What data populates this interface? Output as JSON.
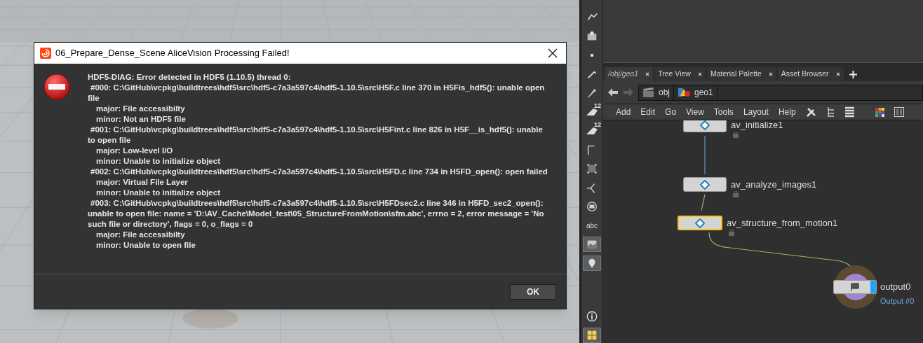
{
  "dialog": {
    "title": "06_Prepare_Dense_Scene AliceVision Processing Failed!",
    "lines": [
      {
        "kind": "heading",
        "text": "HDF5-DIAG: Error detected in HDF5 (1.10.5) thread 0:"
      },
      {
        "kind": "frame",
        "text": "#000: C:\\GitHub\\vcpkg\\buildtrees\\hdf5\\src\\hdf5-c7a3a597c4\\hdf5-1.10.5\\src\\H5F.c line 370 in H5Fis_hdf5(): unable open"
      },
      {
        "kind": "wrap",
        "text": "file"
      },
      {
        "kind": "detail",
        "text": "major: File accessibilty"
      },
      {
        "kind": "detail",
        "text": "minor: Not an HDF5 file"
      },
      {
        "kind": "frame",
        "text": "#001: C:\\GitHub\\vcpkg\\buildtrees\\hdf5\\src\\hdf5-c7a3a597c4\\hdf5-1.10.5\\src\\H5Fint.c line 826 in H5F__is_hdf5(): unable"
      },
      {
        "kind": "wrap",
        "text": "to open file"
      },
      {
        "kind": "detail",
        "text": "major: Low-level I/O"
      },
      {
        "kind": "detail",
        "text": "minor: Unable to initialize object"
      },
      {
        "kind": "frame",
        "text": "#002: C:\\GitHub\\vcpkg\\buildtrees\\hdf5\\src\\hdf5-c7a3a597c4\\hdf5-1.10.5\\src\\H5FD.c line 734 in H5FD_open(): open failed"
      },
      {
        "kind": "detail",
        "text": "major: Virtual File Layer"
      },
      {
        "kind": "detail",
        "text": "minor: Unable to initialize object"
      },
      {
        "kind": "frame",
        "text": "#003: C:\\GitHub\\vcpkg\\buildtrees\\hdf5\\src\\hdf5-c7a3a597c4\\hdf5-1.10.5\\src\\H5FDsec2.c line 346 in H5FD_sec2_open():"
      },
      {
        "kind": "wrap",
        "text": "unable to open file: name = 'D:\\AV_Cache\\Model_test\\05_StructureFromMotion\\sfm.abc', errno = 2, error message = 'No"
      },
      {
        "kind": "wrap",
        "text": "such file or directory', flags = 0, o_flags = 0"
      },
      {
        "kind": "detail",
        "text": "major: File accessibilty"
      },
      {
        "kind": "detail",
        "text": "minor: Unable to open file"
      }
    ],
    "button": "OK"
  },
  "toolbar": [
    {
      "kind": "icon",
      "selected": false
    },
    {
      "kind": "icon",
      "selected": false
    },
    {
      "kind": "icon",
      "selected": false
    },
    {
      "kind": "icon",
      "selected": false
    },
    {
      "kind": "icon",
      "selected": false
    },
    {
      "kind": "badge",
      "label": "12",
      "selected": false
    },
    {
      "kind": "badge",
      "label": "12",
      "selected": false
    },
    {
      "kind": "icon",
      "selected": false
    },
    {
      "kind": "icon",
      "selected": false
    },
    {
      "kind": "icon",
      "selected": false
    },
    {
      "kind": "icon",
      "selected": false
    },
    {
      "kind": "text",
      "label": "abc",
      "selected": false
    },
    {
      "kind": "icon",
      "selected": true
    },
    {
      "kind": "icon",
      "selected": true
    },
    {
      "kind": "spacer"
    },
    {
      "kind": "icon",
      "selected": false
    },
    {
      "kind": "icon",
      "selected": true
    }
  ],
  "tabs": [
    {
      "label": "/obj/geo1",
      "selected": true
    },
    {
      "label": "Tree View",
      "selected": false
    },
    {
      "label": "Material Palette",
      "selected": false
    },
    {
      "label": "Asset Browser",
      "selected": false
    }
  ],
  "path": [
    {
      "label": "obj"
    },
    {
      "label": "geo1"
    }
  ],
  "menu": [
    "Add",
    "Edit",
    "Go",
    "View",
    "Tools",
    "Layout",
    "Help"
  ],
  "nodes": [
    {
      "kind": "subnet",
      "name": "av_initialize1",
      "selected": false
    },
    {
      "kind": "subnet",
      "name": "av_analyze_images1",
      "selected": false
    },
    {
      "kind": "subnet",
      "name": "av_structure_from_motion1",
      "selected": true
    },
    {
      "kind": "output",
      "name": "output0",
      "subtitle": "Output #0",
      "selected": false
    }
  ]
}
